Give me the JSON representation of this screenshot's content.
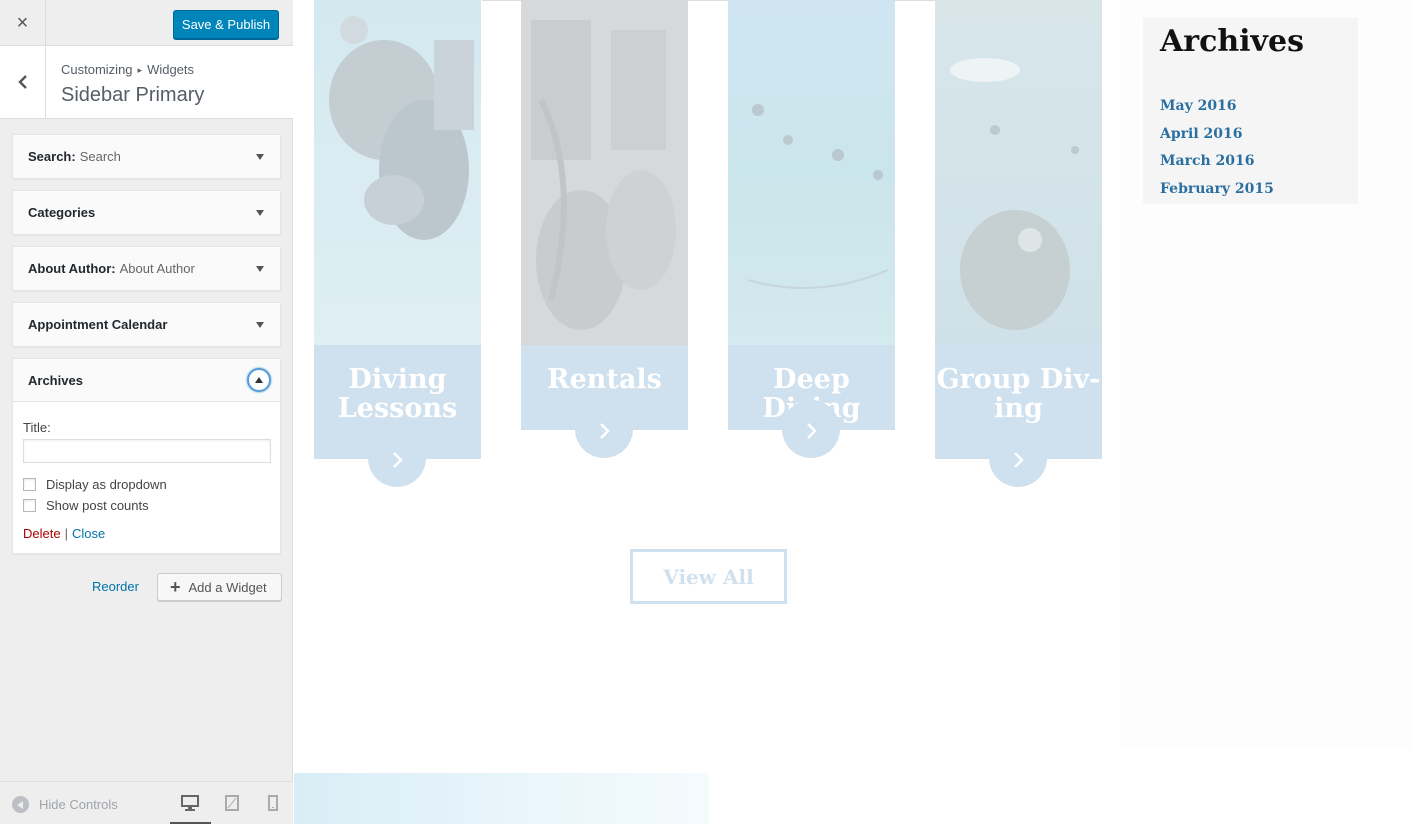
{
  "header": {
    "close_icon": "×",
    "save_label": "Save & Publish"
  },
  "section": {
    "breadcrumb_parent": "Customizing",
    "breadcrumb_separator": "▸",
    "breadcrumb_child": "Widgets",
    "title": "Sidebar Primary"
  },
  "widgets": [
    {
      "name": "Search:",
      "subtitle": "Search"
    },
    {
      "name": "Categories",
      "subtitle": ""
    },
    {
      "name": "About Author:",
      "subtitle": "About Author"
    },
    {
      "name": "Appointment Calendar",
      "subtitle": ""
    },
    {
      "name": "Archives",
      "subtitle": ""
    }
  ],
  "archives_widget": {
    "title_label": "Title:",
    "title_value": "",
    "dropdown_label": "Display as dropdown",
    "dropdown_checked": false,
    "counts_label": "Show post counts",
    "counts_checked": false,
    "delete_label": "Delete",
    "separator": "|",
    "close_label": "Close"
  },
  "actions": {
    "reorder_label": "Reorder",
    "add_widget_label": "Add a Widget"
  },
  "footer": {
    "hide_controls_label": "Hide Controls",
    "devices": [
      "desktop",
      "tablet",
      "mobile"
    ],
    "active_device": "desktop"
  },
  "preview": {
    "services": [
      {
        "label": "Diving Lessons",
        "icon": "chevron-right-icon"
      },
      {
        "label": "Rentals",
        "icon": "chevron-right-icon"
      },
      {
        "label": "Deep Diving",
        "icon": "chevron-right-icon"
      },
      {
        "label": "Group Div-ing",
        "icon": "chevron-right-icon"
      }
    ],
    "view_all_label": "View All",
    "sidebar_archives": {
      "title": "Archives",
      "items": [
        "May 2016",
        "April 2016",
        "March 2016",
        "February 2015"
      ]
    }
  },
  "colors": {
    "accent": "#0085ba",
    "link": "#0073aa",
    "delete": "#aa0000",
    "card_overlay": "#cfe0ee",
    "archive_link": "#2a6fa0"
  }
}
